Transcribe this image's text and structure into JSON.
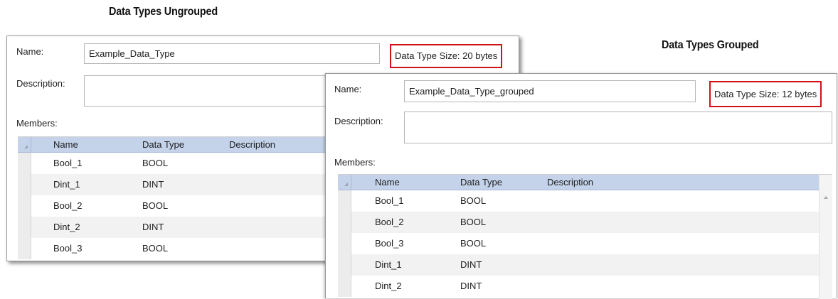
{
  "captions": {
    "ungrouped": "Data Types Ungrouped",
    "grouped": "Data Types Grouped"
  },
  "ungrouped": {
    "name_label": "Name:",
    "name_value": "Example_Data_Type",
    "size_text": "Data Type Size: 20 bytes",
    "description_label": "Description:",
    "description_value": "",
    "members_label": "Members:",
    "columns": [
      "Name",
      "Data Type",
      "Description"
    ],
    "rows": [
      {
        "name": "Bool_1",
        "type": "BOOL"
      },
      {
        "name": "Dint_1",
        "type": "DINT"
      },
      {
        "name": "Bool_2",
        "type": "BOOL"
      },
      {
        "name": "Dint_2",
        "type": "DINT"
      },
      {
        "name": "Bool_3",
        "type": "BOOL"
      }
    ]
  },
  "grouped": {
    "name_label": "Name:",
    "name_value": "Example_Data_Type_grouped",
    "size_text": "Data Type Size: 12 bytes",
    "description_label": "Description:",
    "description_value": "",
    "members_label": "Members:",
    "columns": [
      "Name",
      "Data Type",
      "Description"
    ],
    "rows": [
      {
        "name": "Bool_1",
        "type": "BOOL"
      },
      {
        "name": "Bool_2",
        "type": "BOOL"
      },
      {
        "name": "Bool_3",
        "type": "BOOL"
      },
      {
        "name": "Dint_1",
        "type": "DINT"
      },
      {
        "name": "Dint_2",
        "type": "DINT"
      }
    ]
  },
  "colors": {
    "highlight": "#d0121b",
    "grid_header": "#c4d3ea"
  }
}
